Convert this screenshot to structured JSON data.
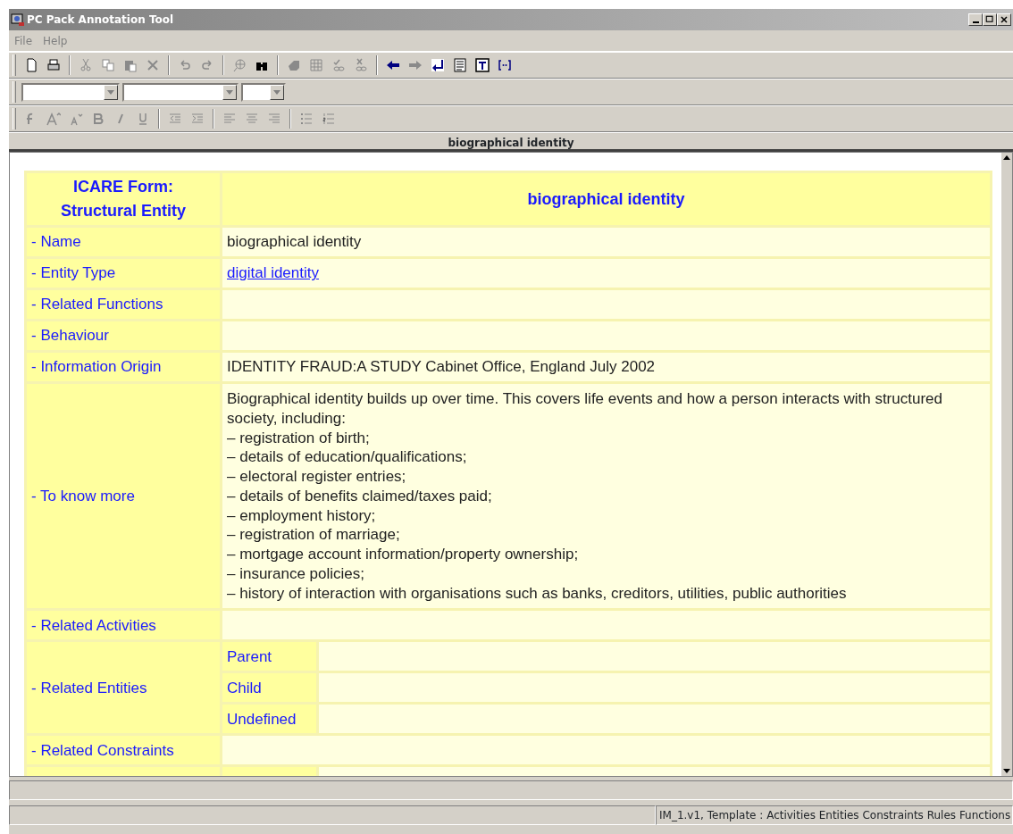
{
  "window": {
    "title": "PC Pack Annotation Tool"
  },
  "menu": [
    "File",
    "Help"
  ],
  "toolbar_main": [
    {
      "disabled": false
    },
    {
      "disabled": false
    },
    {
      "disabled": true
    },
    {
      "disabled": true
    },
    {
      "disabled": true
    },
    {
      "disabled": true
    },
    {
      "disabled": true
    },
    {
      "disabled": true
    },
    {
      "disabled": true
    },
    {
      "disabled": false
    },
    {
      "disabled": true
    },
    {
      "disabled": true
    },
    {
      "disabled": true
    },
    {
      "disabled": true
    },
    {
      "disabled": false
    },
    {
      "disabled": true
    },
    {
      "disabled": false
    },
    {
      "disabled": false
    },
    {
      "disabled": false
    },
    {
      "disabled": false
    }
  ],
  "toolbar_format": [
    {
      "disabled": true
    },
    {
      "disabled": true
    },
    {
      "disabled": true
    },
    {
      "disabled": true
    },
    {
      "disabled": true
    },
    {
      "disabled": true
    },
    {
      "disabled": true
    },
    {
      "disabled": true
    },
    {
      "disabled": true
    },
    {
      "disabled": true
    },
    {
      "disabled": true
    },
    {
      "disabled": true
    },
    {
      "disabled": true
    }
  ],
  "document_title": "biographical identity",
  "form": {
    "heading": "ICARE Form: Structural Entity",
    "title": "biographical identity",
    "rows": [
      {
        "kind": "text",
        "label": "- Name",
        "value": "biographical identity"
      },
      {
        "kind": "link",
        "label": "- Entity Type",
        "value": "digital identity"
      },
      {
        "kind": "text",
        "label": "- Related Functions"
      },
      {
        "kind": "text",
        "label": "- Behaviour"
      },
      {
        "kind": "text",
        "label": "- Information Origin",
        "value": "IDENTITY FRAUD:A STUDY Cabinet Office, England July 2002"
      },
      {
        "kind": "lines",
        "label": "- To know more",
        "lines": [
          "Biographical identity builds up over time. This covers life events and how a person interacts with structured society, including:",
          "– registration of birth;",
          "– details of education/qualifications;",
          "– electoral register entries;",
          "– details of benefits claimed/taxes paid;",
          "– employment history;",
          "– registration of marriage;",
          "– mortgage account information/property ownership;",
          "– insurance policies;",
          "– history of interaction with organisations such as banks, creditors, utilities, public authorities"
        ]
      },
      {
        "kind": "text",
        "label": "- Related Activities"
      },
      {
        "kind": "sub",
        "label": "- Related Entities",
        "subs": [
          "Parent",
          "Child",
          "Undefined"
        ]
      },
      {
        "kind": "text",
        "label": "- Related Constraints"
      }
    ]
  },
  "status_bar": "IM_1.v1,  Template : Activities Entities Constraints Rules Functions"
}
